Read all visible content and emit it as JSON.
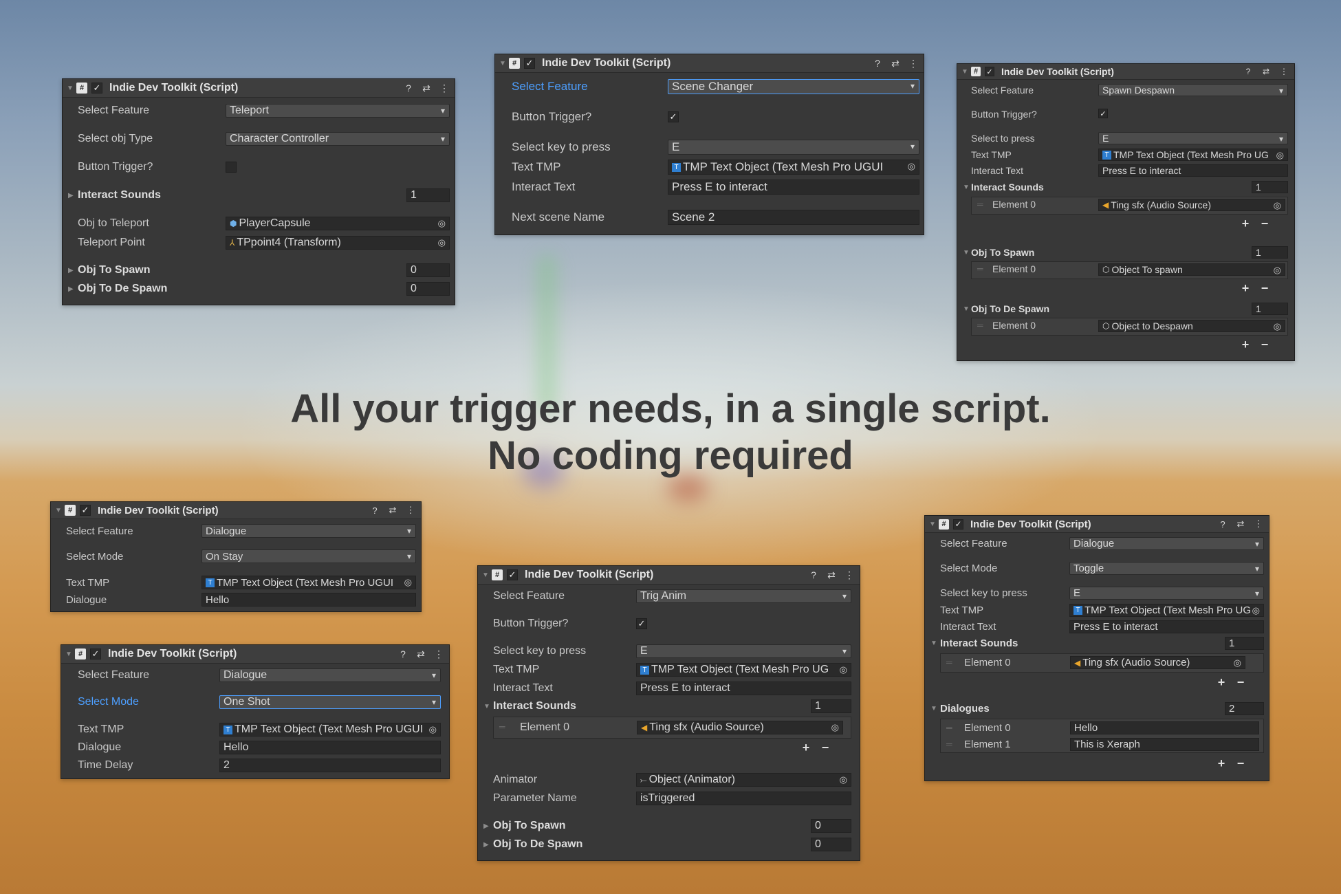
{
  "tagline": {
    "line1": "All your trigger needs, in a single script.",
    "line2": "No coding required"
  },
  "panel_title": "Indie Dev Toolkit (Script)",
  "header_icons": {
    "help": "?",
    "preset": "⇄",
    "menu": "⋮",
    "hash": "#",
    "check": "✓"
  },
  "list_buttons": {
    "add": "+",
    "remove": "−"
  },
  "panels": {
    "teleport": {
      "select_feature_label": "Select Feature",
      "select_feature_value": "Teleport",
      "select_obj_type_label": "Select obj Type",
      "select_obj_type_value": "Character Controller",
      "button_trigger_label": "Button Trigger?",
      "interact_sounds_label": "Interact Sounds",
      "interact_sounds_count": "1",
      "obj_to_teleport_label": "Obj to Teleport",
      "obj_to_teleport_value": "PlayerCapsule",
      "teleport_point_label": "Teleport Point",
      "teleport_point_value": "TPpoint4 (Transform)",
      "obj_to_spawn_label": "Obj To Spawn",
      "obj_to_spawn_count": "0",
      "obj_to_despawn_label": "Obj To De Spawn",
      "obj_to_despawn_count": "0"
    },
    "scene_changer": {
      "select_feature_label": "Select Feature",
      "select_feature_value": "Scene Changer",
      "button_trigger_label": "Button Trigger?",
      "select_key_label": "Select key to press",
      "select_key_value": "E",
      "text_tmp_label": "Text TMP",
      "text_tmp_value": "TMP Text Object (Text Mesh Pro UGUI",
      "interact_text_label": "Interact Text",
      "interact_text_value": "Press E to interact",
      "next_scene_label": "Next scene Name",
      "next_scene_value": "Scene 2"
    },
    "spawn_despawn": {
      "select_feature_label": "Select Feature",
      "select_feature_value": "Spawn Despawn",
      "button_trigger_label": "Button Trigger?",
      "select_key_label": "Select to press",
      "select_key_value": "E",
      "text_tmp_label": "Text TMP",
      "text_tmp_value": "TMP Text Object (Text Mesh Pro UG",
      "interact_text_label": "Interact Text",
      "interact_text_value": "Press E to interact",
      "interact_sounds_label": "Interact Sounds",
      "interact_sounds_count": "1",
      "interact_sounds_el0_label": "Element 0",
      "interact_sounds_el0_value": "Ting sfx (Audio Source)",
      "obj_to_spawn_label": "Obj To Spawn",
      "obj_to_spawn_count": "1",
      "obj_to_spawn_el0_label": "Element 0",
      "obj_to_spawn_el0_value": "Object To spawn",
      "obj_to_despawn_label": "Obj To De Spawn",
      "obj_to_despawn_count": "1",
      "obj_to_despawn_el0_label": "Element 0",
      "obj_to_despawn_el0_value": "Object to Despawn"
    },
    "dialogue_on_stay": {
      "select_feature_label": "Select Feature",
      "select_feature_value": "Dialogue",
      "select_mode_label": "Select Mode",
      "select_mode_value": "On Stay",
      "text_tmp_label": "Text TMP",
      "text_tmp_value": "TMP Text Object (Text Mesh Pro UGUI",
      "dialogue_label": "Dialogue",
      "dialogue_value": "Hello"
    },
    "dialogue_one_shot": {
      "select_feature_label": "Select Feature",
      "select_feature_value": "Dialogue",
      "select_mode_label": "Select Mode",
      "select_mode_value": "One Shot",
      "text_tmp_label": "Text TMP",
      "text_tmp_value": "TMP Text Object (Text Mesh Pro UGUI",
      "dialogue_label": "Dialogue",
      "dialogue_value": "Hello",
      "time_delay_label": "Time Delay",
      "time_delay_value": "2"
    },
    "trig_anim": {
      "select_feature_label": "Select Feature",
      "select_feature_value": "Trig Anim",
      "button_trigger_label": "Button Trigger?",
      "select_key_label": "Select key to press",
      "select_key_value": "E",
      "text_tmp_label": "Text TMP",
      "text_tmp_value": "TMP Text Object (Text Mesh Pro UG",
      "interact_text_label": "Interact Text",
      "interact_text_value": "Press E to interact",
      "interact_sounds_label": "Interact Sounds",
      "interact_sounds_count": "1",
      "interact_sounds_el0_label": "Element 0",
      "interact_sounds_el0_value": "Ting sfx (Audio Source)",
      "animator_label": "Animator",
      "animator_value": "Object (Animator)",
      "parameter_name_label": "Parameter Name",
      "parameter_name_value": "isTriggered",
      "obj_to_spawn_label": "Obj To Spawn",
      "obj_to_spawn_count": "0",
      "obj_to_despawn_label": "Obj To De Spawn",
      "obj_to_despawn_count": "0"
    },
    "dialogue_toggle": {
      "select_feature_label": "Select Feature",
      "select_feature_value": "Dialogue",
      "select_mode_label": "Select Mode",
      "select_mode_value": "Toggle",
      "select_key_label": "Select key to press",
      "select_key_value": "E",
      "text_tmp_label": "Text TMP",
      "text_tmp_value": "TMP Text Object (Text Mesh Pro UG",
      "interact_text_label": "Interact Text",
      "interact_text_value": "Press E to interact",
      "interact_sounds_label": "Interact Sounds",
      "interact_sounds_count": "1",
      "interact_sounds_el0_label": "Element 0",
      "interact_sounds_el0_value": "Ting sfx (Audio Source)",
      "dialogues_label": "Dialogues",
      "dialogues_count": "2",
      "dialogues_el0_label": "Element 0",
      "dialogues_el0_value": "Hello",
      "dialogues_el1_label": "Element 1",
      "dialogues_el1_value": "This is Xeraph"
    }
  }
}
